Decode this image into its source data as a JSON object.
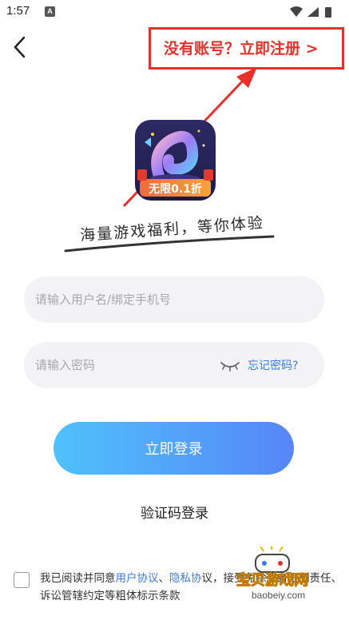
{
  "status_bar": {
    "time": "1:57",
    "a_icon": "A"
  },
  "header": {
    "back_icon": "chevron-left-icon",
    "register_link": "没有账号？立即注册 >",
    "highlight_color": "#e8302a"
  },
  "logo": {
    "badge_text": "无限0.1折"
  },
  "tagline": "海量游戏福利，等你体验",
  "form": {
    "username_placeholder": "请输入用户名/绑定手机号",
    "password_placeholder": "请输入密码",
    "forgot_password": "忘记密码?",
    "login_button": "立即登录",
    "code_login": "验证码登录"
  },
  "agreement": {
    "prefix": "我已阅读并同意",
    "user_agreement": "用户协议",
    "separator": "、",
    "privacy_agreement": "隐私协",
    "suffix": "议，接受免除或者限制责任、诉讼管辖约定等粗体标示条款"
  },
  "watermark": {
    "text": "宝贝游戏网",
    "url": "baobeiy.com"
  },
  "colors": {
    "accent_link": "#3c7bf0",
    "button_gradient_start": "#4fc2fb",
    "button_gradient_end": "#5686f8"
  }
}
